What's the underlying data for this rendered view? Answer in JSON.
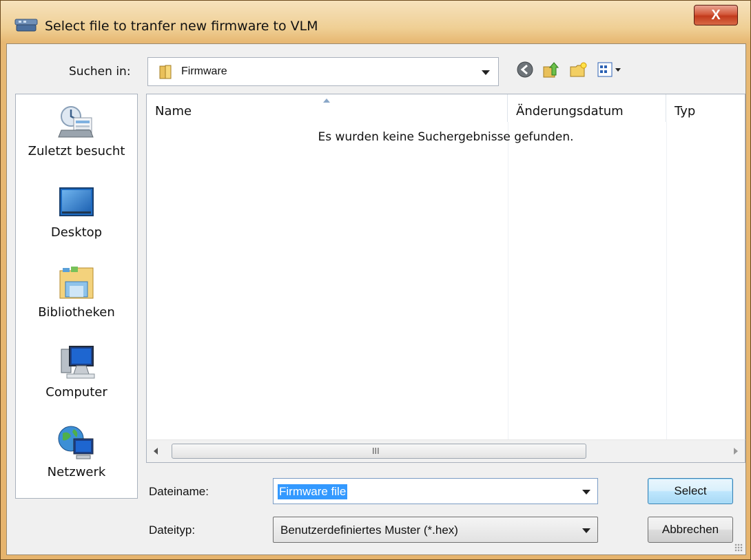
{
  "window": {
    "title": "Select file to tranfer new firmware to VLM",
    "close_label": "X"
  },
  "toolbar": {
    "lookin_label": "Suchen in:",
    "lookin_value": "Firmware",
    "icons": [
      "back-icon",
      "up-folder-icon",
      "new-folder-icon",
      "view-menu-icon"
    ]
  },
  "places": [
    {
      "label": "Zuletzt besucht",
      "icon": "recent-places-icon"
    },
    {
      "label": "Desktop",
      "icon": "desktop-icon"
    },
    {
      "label": "Bibliotheken",
      "icon": "libraries-icon"
    },
    {
      "label": "Computer",
      "icon": "computer-icon"
    },
    {
      "label": "Netzwerk",
      "icon": "network-icon"
    }
  ],
  "filelist": {
    "columns": [
      "Name",
      "Änderungsdatum",
      "Typ"
    ],
    "empty_message": "Es wurden keine Suchergebnisse gefunden.",
    "scroll_grip": "III"
  },
  "form": {
    "filename_label": "Dateiname:",
    "filename_value": "Firmware file",
    "filetype_label": "Dateityp:",
    "filetype_value": "Benutzerdefiniertes Muster (*.hex)"
  },
  "buttons": {
    "select": "Select",
    "cancel": "Abbrechen"
  }
}
